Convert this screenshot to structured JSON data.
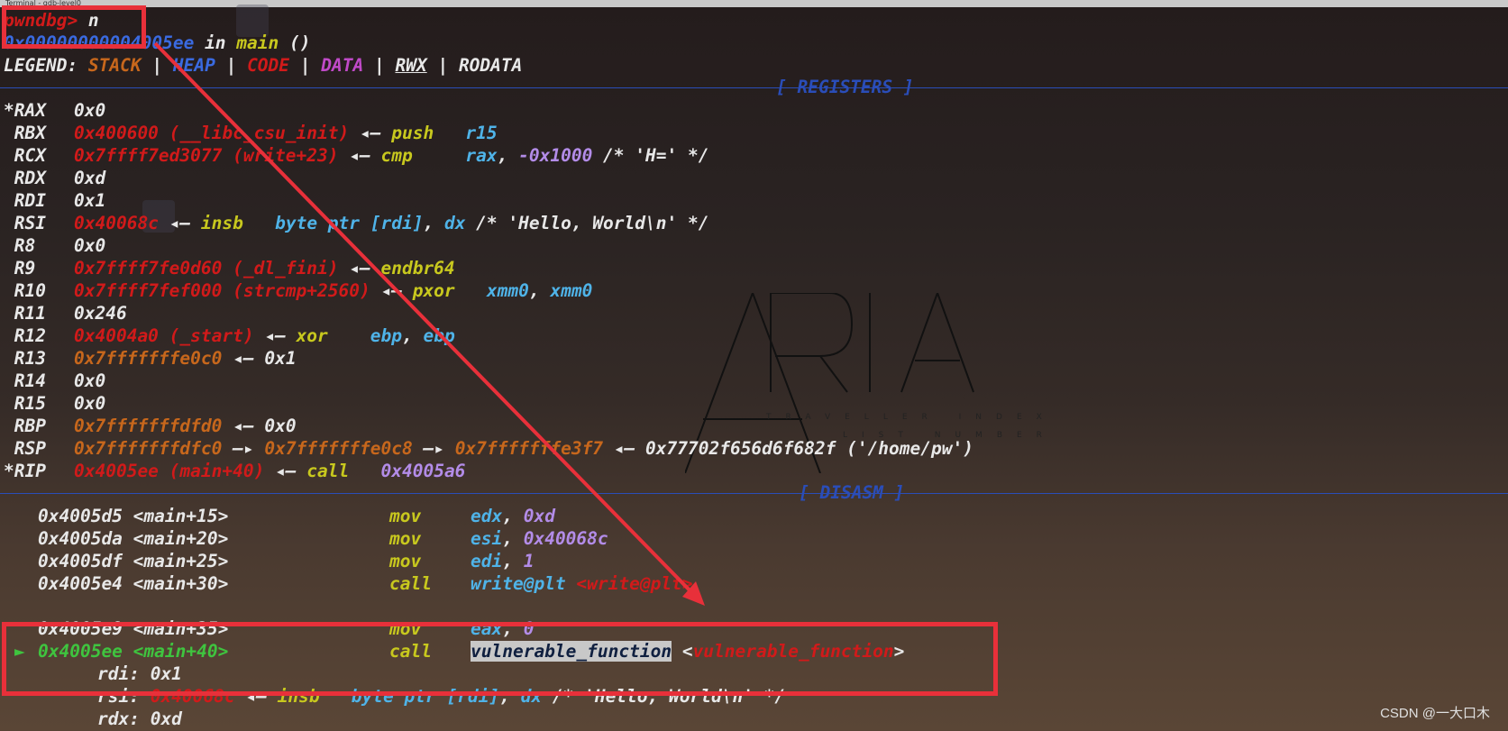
{
  "window": {
    "title": "Terminal - gdb-level0"
  },
  "prompt": {
    "text": "pwndbg> ",
    "command": "n"
  },
  "location": {
    "address": "0x00000000004005ee",
    "in": " in ",
    "func": "main",
    "args": " ()"
  },
  "legend": {
    "label": "LEGEND: ",
    "stack": "STACK",
    "heap": "HEAP",
    "code": "CODE",
    "data": "DATA",
    "rwx": "RWX",
    "rodata": "RODATA",
    "sep": " | "
  },
  "registers_header": "[ REGISTERS ]",
  "disasm_header": "[ DISASM ]",
  "registers": {
    "rax": {
      "name": "*RAX",
      "value": "0x0"
    },
    "rbx": {
      "name": " RBX",
      "value": "0x400600 (__libc_csu_init)",
      "arrow": " ◂— ",
      "ins": "push",
      "ops": "r15"
    },
    "rcx": {
      "name": " RCX",
      "value": "0x7ffff7ed3077 (write+23)",
      "arrow": " ◂— ",
      "ins": "cmp",
      "op1": "rax",
      "op2": "-0x1000",
      "comment": " /* 'H=' */"
    },
    "rdx": {
      "name": " RDX",
      "value": "0xd"
    },
    "rdi": {
      "name": " RDI",
      "value": "0x1"
    },
    "rsi": {
      "name": " RSI",
      "value": "0x40068c",
      "arrow": " ◂— ",
      "ins": "insb",
      "op1": "byte ptr [rdi]",
      "op2": "dx",
      "comment": " /* 'Hello, World\\n' */"
    },
    "r8": {
      "name": " R8",
      "value": "0x0"
    },
    "r9": {
      "name": " R9",
      "value": "0x7ffff7fe0d60 (_dl_fini)",
      "arrow": " ◂— ",
      "ins": "endbr64"
    },
    "r10": {
      "name": " R10",
      "value": "0x7ffff7fef000 (strcmp+2560)",
      "arrow": " ◂— ",
      "ins": "pxor",
      "op1": "xmm0",
      "op2": "xmm0"
    },
    "r11": {
      "name": " R11",
      "value": "0x246"
    },
    "r12": {
      "name": " R12",
      "value": "0x4004a0 (_start)",
      "arrow": " ◂— ",
      "ins": "xor",
      "op1": "ebp",
      "op2": "ebp"
    },
    "r13": {
      "name": " R13",
      "value": "0x7fffffffe0c0",
      "arrow": " ◂— ",
      "target": "0x1"
    },
    "r14": {
      "name": " R14",
      "value": "0x0"
    },
    "r15": {
      "name": " R15",
      "value": "0x0"
    },
    "rbp": {
      "name": " RBP",
      "value": "0x7fffffffdfd0",
      "arrow": " ◂— ",
      "target": "0x0"
    },
    "rsp": {
      "name": " RSP",
      "value": "0x7fffffffdfc0",
      "a1": " —▸ ",
      "v2": "0x7fffffffe0c8",
      "a2": " —▸ ",
      "v3": "0x7fffffffe3f7",
      "a3": " ◂— ",
      "v4": "0x77702f656d6f682f ('/home/pw')"
    },
    "rip": {
      "name": "*RIP",
      "value": "0x4005ee (main+40)",
      "arrow": " ◂— ",
      "ins": "call",
      "target": "0x4005a6"
    }
  },
  "disasm": [
    {
      "addr": "0x4005d5 <main+15>",
      "ins": "mov",
      "op1": "edx",
      "op2": "0xd"
    },
    {
      "addr": "0x4005da <main+20>",
      "ins": "mov",
      "op1": "esi",
      "op2": "0x40068c"
    },
    {
      "addr": "0x4005df <main+25>",
      "ins": "mov",
      "op1": "edi",
      "op2": "1"
    },
    {
      "addr": "0x4005e4 <main+30>",
      "ins": "call",
      "op1": "write@plt",
      "sym": "<write@plt>"
    },
    {
      "addr": "0x4005e9 <main+35>",
      "ins": "mov",
      "op1": "eax",
      "op2": "0"
    },
    {
      "marker": "►",
      "addr": "0x4005ee <main+40>",
      "ins": "call",
      "op1": "vulnerable_function",
      "sym_open": "<",
      "sym": "vulnerable_function",
      "sym_close": ">"
    }
  ],
  "args": {
    "rdi": {
      "label": "rdi: ",
      "value": "0x1"
    },
    "rsi": {
      "label": "rsi: ",
      "value": "0x40068c",
      "arrow": " ◂— ",
      "ins": "insb",
      "op1": "byte ptr [rdi]",
      "op2": "dx",
      "comment": " /* 'Hello, World\\n' */"
    },
    "rdx": {
      "label": "rdx: ",
      "value": "0xd"
    }
  },
  "background_logo": {
    "text": "ARIA",
    "sub1": "TRAVELLER INDEX",
    "sub2": "LIST NUMBER"
  },
  "watermark": "CSDN @一大口木",
  "colors": {
    "highlight_box": "#e8303a",
    "separator": "#2a4db8",
    "arrow": "#e8303a"
  }
}
